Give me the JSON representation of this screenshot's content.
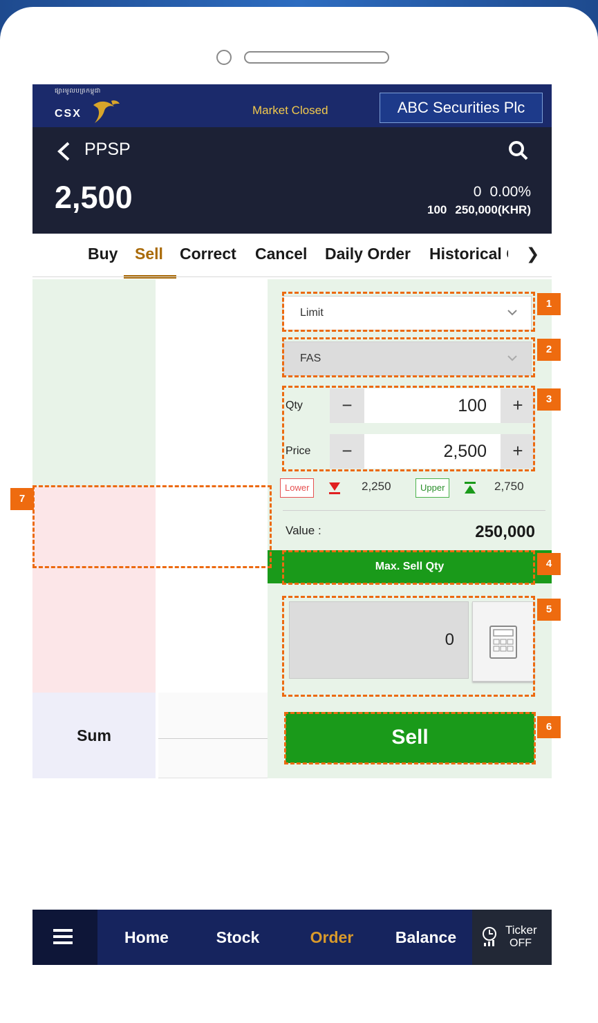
{
  "header": {
    "logo_khmer": "ផ្សារមូលបត្រកម្ពុជា",
    "logo_text": "CSX",
    "market_status": "Market Closed",
    "broker": "ABC Securities Plc"
  },
  "stock": {
    "symbol": "PPSP",
    "price": "2,500",
    "change": "0",
    "change_pct": "0.00%",
    "volume": "100",
    "turnover": "250,000(KHR)"
  },
  "tabs": {
    "buy": "Buy",
    "sell": "Sell",
    "correct": "Correct",
    "cancel": "Cancel",
    "daily_order": "Daily Order",
    "historical": "Historical Order"
  },
  "order_book": {
    "sum_label": "Sum"
  },
  "order_form": {
    "order_type": "Limit",
    "account_type": "FAS",
    "qty_label": "Qty",
    "qty_value": "100",
    "price_label": "Price",
    "price_value": "2,500",
    "minus": "−",
    "plus": "+",
    "lower_label": "Lower",
    "lower_value": "2,250",
    "upper_label": "Upper",
    "upper_value": "2,750",
    "value_label": "Value :",
    "value_amount": "250,000",
    "max_sell_label": "Max. Sell Qty",
    "max_sell_value": "0",
    "sell_button": "Sell"
  },
  "annotations": [
    "1",
    "2",
    "3",
    "4",
    "5",
    "6",
    "7"
  ],
  "bottom_nav": {
    "home": "Home",
    "stock": "Stock",
    "order": "Order",
    "balance": "Balance",
    "ticker_l1": "Ticker",
    "ticker_l2": "OFF"
  },
  "colors": {
    "header_blue": "#1b2a6b",
    "accent_gold": "#a96a08",
    "sell_green": "#1a9a1a",
    "annotation_orange": "#ee6b0f",
    "bid_pink": "#fce6e8",
    "ask_green": "#e8f3e8"
  },
  "icons": [
    "back-chevron-icon",
    "search-icon",
    "chevron-down-icon",
    "triangle-down-icon",
    "triangle-up-icon",
    "calculator-icon",
    "menu-icon",
    "ticker-icon"
  ]
}
